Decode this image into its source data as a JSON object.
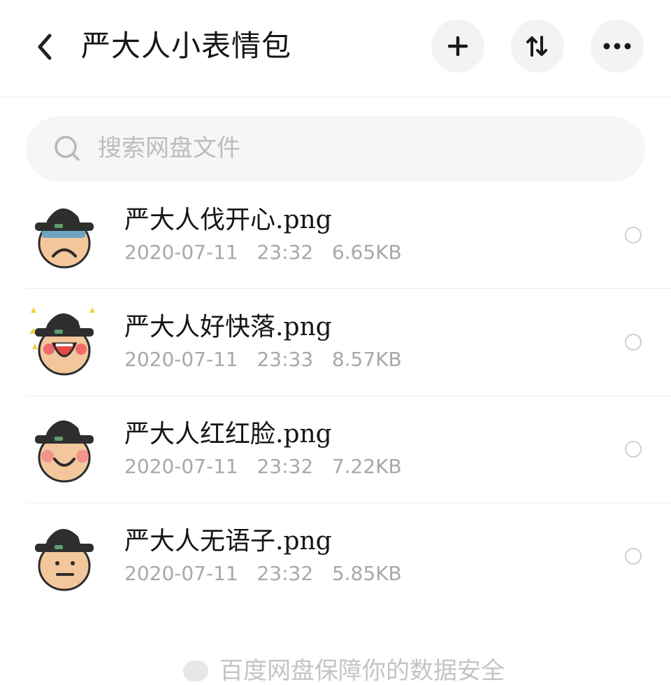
{
  "header": {
    "title": "严大人小表情包",
    "back_icon": "chevron-left-icon",
    "add_icon": "plus-icon",
    "sort_icon": "sort-icon",
    "more_icon": "more-horizontal-icon"
  },
  "search": {
    "placeholder": "搜索网盘文件",
    "icon": "search-icon"
  },
  "files": [
    {
      "name": "严大人伐开心.png",
      "date": "2020-07-11",
      "time": "23:32",
      "size": "6.65KB",
      "thumbnail_icon": "sad-face-sticker",
      "selected": false
    },
    {
      "name": "严大人好快落.png",
      "date": "2020-07-11",
      "time": "23:33",
      "size": "8.57KB",
      "thumbnail_icon": "laughing-face-sticker",
      "selected": false
    },
    {
      "name": "严大人红红脸.png",
      "date": "2020-07-11",
      "time": "23:32",
      "size": "7.22KB",
      "thumbnail_icon": "blushing-face-sticker",
      "selected": false
    },
    {
      "name": "严大人无语子.png",
      "date": "2020-07-11",
      "time": "23:32",
      "size": "5.85KB",
      "thumbnail_icon": "speechless-face-sticker",
      "selected": false
    }
  ],
  "footer": {
    "text": "百度网盘保障你的数据安全",
    "icon": "shield-icon"
  },
  "colors": {
    "accent_bg": "#f3f3f3",
    "meta_text": "#a8a8a8",
    "placeholder": "#bdbdbd"
  }
}
